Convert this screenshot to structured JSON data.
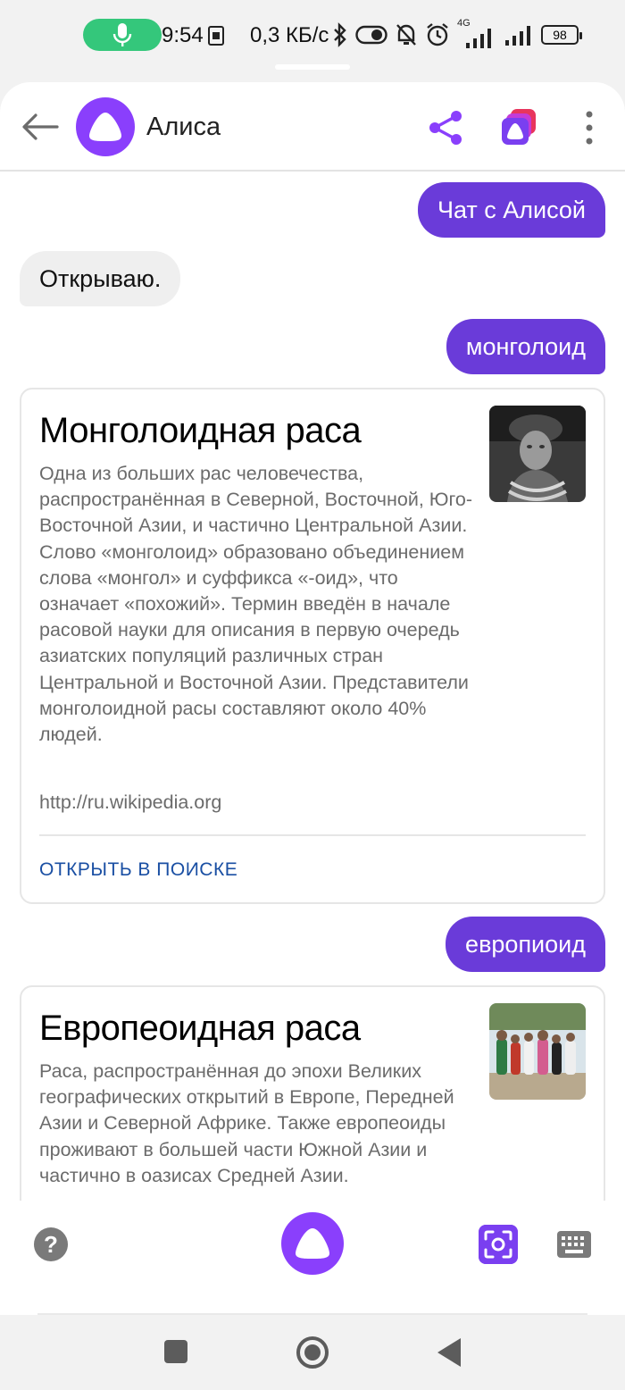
{
  "status_bar": {
    "time": "9:54",
    "speed": "0,3 КБ/с",
    "network_type": "4G",
    "battery": "98",
    "icons": [
      "mic-icon",
      "sim-card-icon",
      "bluetooth-icon",
      "toggle-icon",
      "bell-off-icon",
      "alarm-icon",
      "signal-icon",
      "signal-icon",
      "battery-icon"
    ]
  },
  "header": {
    "title": "Алиса",
    "icons": [
      "back-arrow-icon",
      "alice-logo-icon",
      "share-icon",
      "stack-icon",
      "more-vertical-icon"
    ]
  },
  "messages": {
    "user_1": "Чат с Алисой",
    "bot_1": "Открываю.",
    "user_2": "монголоид",
    "card_1": {
      "title": "Монголоидная раса",
      "text": "Одна из больших рас человечества, распространённая в Северной, Восточной, Юго-Восточной Азии, и частично Центральной Азии. Слово «монголоид» образовано объединением слова «монгол» и суффикса «-оид», что означает «похожий». Термин введён в начале расовой науки для описания в первую очередь азиатских популяций различных стран Центральной и Восточной Азии. Представители монголоидной расы составляют около 40% людей.",
      "url": "http://ru.wikipedia.org",
      "link": "ОТКРЫТЬ В ПОИСКЕ"
    },
    "user_3": "европиоид",
    "card_2": {
      "title": "Европеоидная раса",
      "text": "Раса, распространённая до эпохи Великих географических открытий в Европе, Передней Азии и Северной Африке. Также европеоиды проживают в большей части Южной Азии и частично в оазисах Средней Азии."
    }
  },
  "bottom_bar": {
    "help_label": "?",
    "icons": [
      "help-icon",
      "alice-voice-icon",
      "camera-scan-icon",
      "keyboard-icon"
    ]
  },
  "colors": {
    "accent": "#8a3ffc",
    "user_bubble": "#6a3bd9",
    "link": "#1a4fa3",
    "mic_pill": "#34c77b"
  }
}
